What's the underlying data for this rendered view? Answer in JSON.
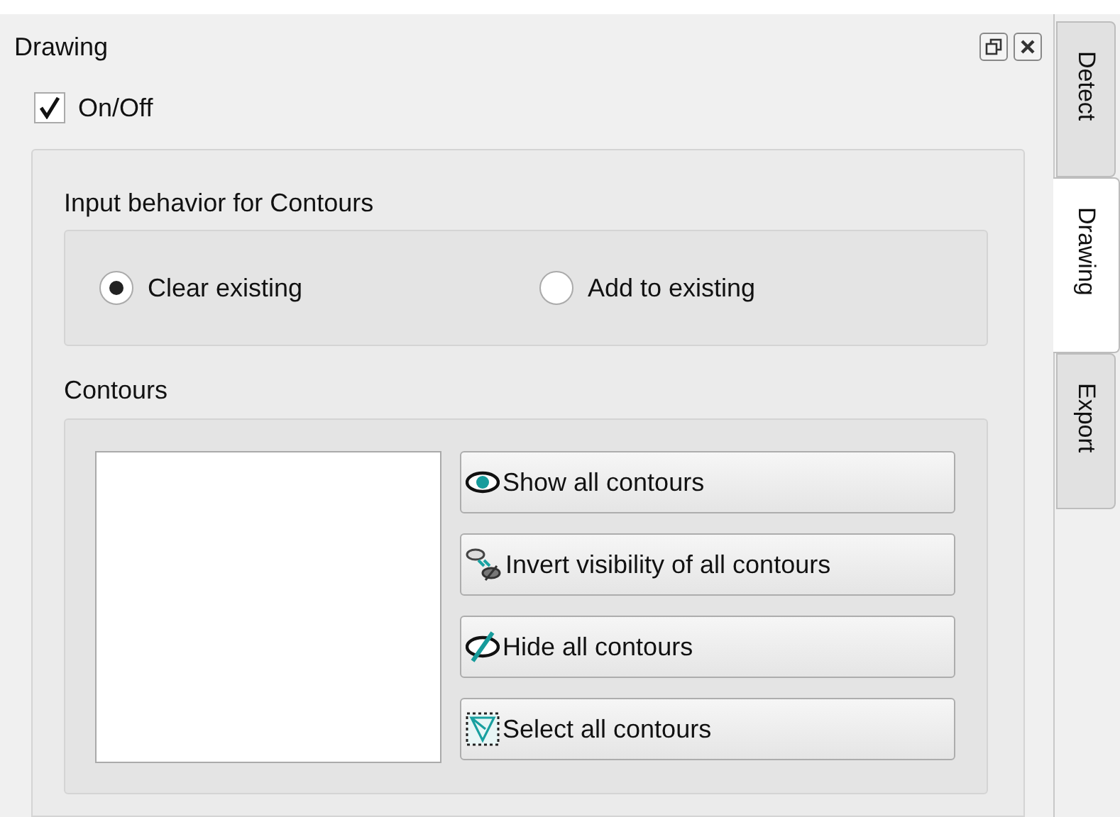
{
  "panel": {
    "title": "Drawing"
  },
  "enabled": {
    "label": "On/Off",
    "checked": true
  },
  "input_behavior": {
    "title": "Input behavior for Contours",
    "options": [
      {
        "label": "Clear existing",
        "selected": true
      },
      {
        "label": "Add to existing",
        "selected": false
      }
    ]
  },
  "contours": {
    "title": "Contours",
    "buttons": [
      {
        "label": "Show all contours",
        "kind": "show"
      },
      {
        "label": "Invert visibility of all contours",
        "kind": "invert"
      },
      {
        "label": "Hide all contours",
        "kind": "hide"
      },
      {
        "label": "Select all contours",
        "kind": "select"
      }
    ]
  },
  "tabs": [
    {
      "label": "Detect",
      "selected": false
    },
    {
      "label": "Drawing",
      "selected": true
    },
    {
      "label": "Export",
      "selected": false
    }
  ]
}
